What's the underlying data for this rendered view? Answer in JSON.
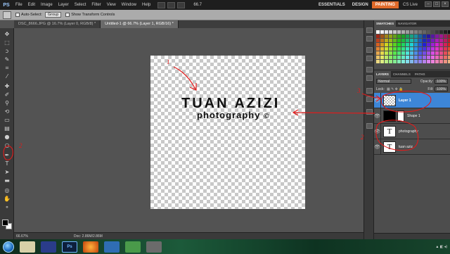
{
  "app": {
    "logo": "PS"
  },
  "menu": {
    "items": [
      "File",
      "Edit",
      "Image",
      "Layer",
      "Select",
      "Filter",
      "View",
      "Window",
      "Help"
    ],
    "zoom": "66.7"
  },
  "workspaces": [
    "ESSENTIALS",
    "DESIGN",
    "PAINTING"
  ],
  "cs_live": "CS Live",
  "options": {
    "auto_select_label": "Auto-Select:",
    "auto_select_value": "Group",
    "transform_label": "Show Transform Controls"
  },
  "tabs": [
    "DSC_8666.JPG @ 16.7% (Layer 0, RGB/8) *",
    "Untitled-1 @ 66.7% (Layer 1, RGB/16) *"
  ],
  "canvas": {
    "title_text": "TUAN AZIZI",
    "subtitle_text": "photography",
    "copyright": "©"
  },
  "status": {
    "zoom": "66.67%",
    "doc": "Doc: 2.86M/2.86M"
  },
  "panels": {
    "swatch_tabs": [
      "SWATCHES",
      "NAVIGATOR"
    ],
    "layer_tabs": [
      "LAYERS",
      "CHANNELS",
      "PATHS"
    ],
    "blend_mode": "Normal",
    "opacity_label": "Opacity:",
    "opacity": "100%",
    "lock_label": "Lock:",
    "fill_label": "Fill:",
    "fill": "100%",
    "layers": [
      {
        "name": "Layer 1",
        "selected": true
      },
      {
        "name": "Shape 1",
        "selected": false
      },
      {
        "name": "photography",
        "selected": false
      },
      {
        "name": "tuan aziz",
        "selected": false
      }
    ]
  },
  "annotations": [
    "1",
    "2",
    "3",
    "2"
  ],
  "colors": {
    "accent_workspace": "#e06a2a",
    "selected_layer": "#3d86d8",
    "annotation": "#e21b1b"
  }
}
